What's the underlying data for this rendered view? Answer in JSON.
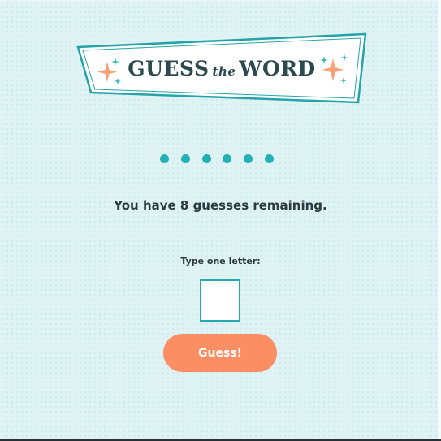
{
  "logo": {
    "word_guess": "GUESS",
    "word_the": "the",
    "word_word": "WORD"
  },
  "word_slots": [
    "",
    "",
    "",
    "",
    "",
    ""
  ],
  "status": {
    "remaining_text": "You have 8 guesses remaining."
  },
  "form": {
    "prompt_label": "Type one letter:",
    "letter_value": "",
    "guess_button_label": "Guess!"
  },
  "colors": {
    "background": "#dff3f5",
    "accent_teal": "#23b1b5",
    "button_orange": "#fb8f63",
    "text_dark": "#2c3a3f",
    "sparkle_orange": "#f7a37a"
  }
}
